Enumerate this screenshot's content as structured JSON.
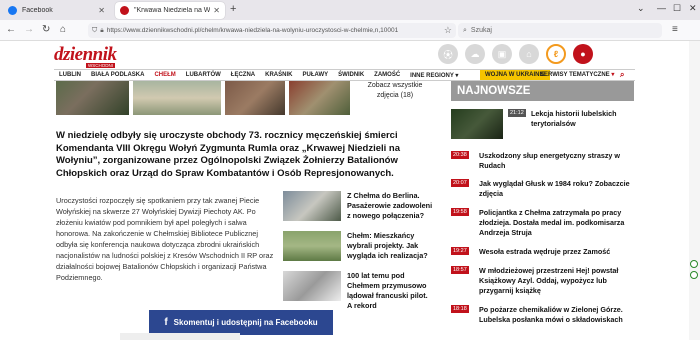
{
  "browser": {
    "tabs": [
      {
        "title": "Facebook",
        "favicon_color": "#1877f2"
      },
      {
        "title": "\"Krwawa Niedziela na Wołyniu\"",
        "favicon_color": "#c1121b"
      }
    ],
    "url": "https://www.dziennikwschodni.pl/chelm/krwawa-niedziela-na-wolyniu-uroczystosci-w-chelmie,n,10001",
    "search_placeholder": "Szukaj"
  },
  "site": {
    "logo": "dziennik",
    "logo_sub": "WSCHODNI",
    "accent": "#c1121b",
    "header_icons": [
      "football-icon",
      "weather-icon",
      "briefcase-icon",
      "home-icon",
      "lublin-logo-icon",
      "user-icon"
    ],
    "menu": [
      "LUBLIN",
      "BIAŁA PODLASKA",
      "CHEŁM",
      "LUBARTÓW",
      "ŁĘCZNA",
      "KRAŚNIK",
      "PUŁAWY",
      "ŚWIDNIK",
      "ZAMOŚĆ",
      "INNE REGIONY"
    ],
    "menu_active_index": 2,
    "menu_ukraine": "WOJNA W UKRAINIE",
    "menu_serwisy": "SERWISY TEMATYCZNE"
  },
  "article": {
    "gallery_link": "Zobacz wszystkie zdjęcia (18)",
    "lead": "W niedzielę odbyły się uroczyste obchody 73. rocznicy męczeńskiej śmierci Komendanta VIII Okręgu Wołyń Zygmunta Rumla oraz „Krwawej Niedzieli na Wołyniu”, zorganizowane przez Ogólnopolski Związek Żołnierzy Batalionów Chłopskich oraz Urząd do Spraw Kombatantów i Osób Represjonowanych.",
    "body": "Uroczystości rozpoczęły się spotkaniem przy tak zwanej Piecie Wołyńskiej na skwerze 27 Wołyńskiej Dywizji Piechoty AK. Po złożeniu kwiatów pod pomnikiem był apel poległych i salwa honorowa. Na zakończenie w Chełmskiej Bibliotece Publicznej odbyła się konferencja naukowa dotycząca zbrodni ukraińskich nacjonalistów na ludności polskiej z Kresów Wschodnich II RP oraz działalności bojowej Batalionów Chłopskich i organizacji Państwa Podziemnego.",
    "related": [
      {
        "title": "Z Chełma do Berlina. Pasażerowie zadowoleni z nowego połączenia?"
      },
      {
        "title": "Chełm: Mieszkańcy wybrali projekty. Jak wygląda ich realizacja?"
      },
      {
        "title": "100 lat temu pod Chełmem przymusowo lądował francuski pilot. A rekord"
      }
    ],
    "share_label": "Skomentuj i udostępnij na Facebooku"
  },
  "sidebar": {
    "heading": "NAJNOWSZE",
    "top": {
      "time": "21:12",
      "title": "Lekcja historii lubelskich terytorialsów"
    },
    "news": [
      {
        "time": "20:38",
        "title": "Uszkodzony słup energetyczny straszy w Rudach"
      },
      {
        "time": "20:07",
        "title": "Jak wyglądał Głusk w 1984 roku? Zobaczcie zdjęcia"
      },
      {
        "time": "19:58",
        "title": "Policjantka z Chełma zatrzymała po pracy złodzieja. Dostała medal im. podkomisarza Andrzeja Struja"
      },
      {
        "time": "19:27",
        "title": "Wesoła estrada wędruje przez Zamość"
      },
      {
        "time": "18:57",
        "title": "W młodzieżowej przestrzeni Hej! powstał Książkowy Azyl. Oddaj, wypożycz lub przygarnij książkę"
      },
      {
        "time": "18:18",
        "title": "Po pożarze chemikaliów w Zielonej Górze. Lubelska posłanka mówi o składowiskach"
      }
    ]
  }
}
